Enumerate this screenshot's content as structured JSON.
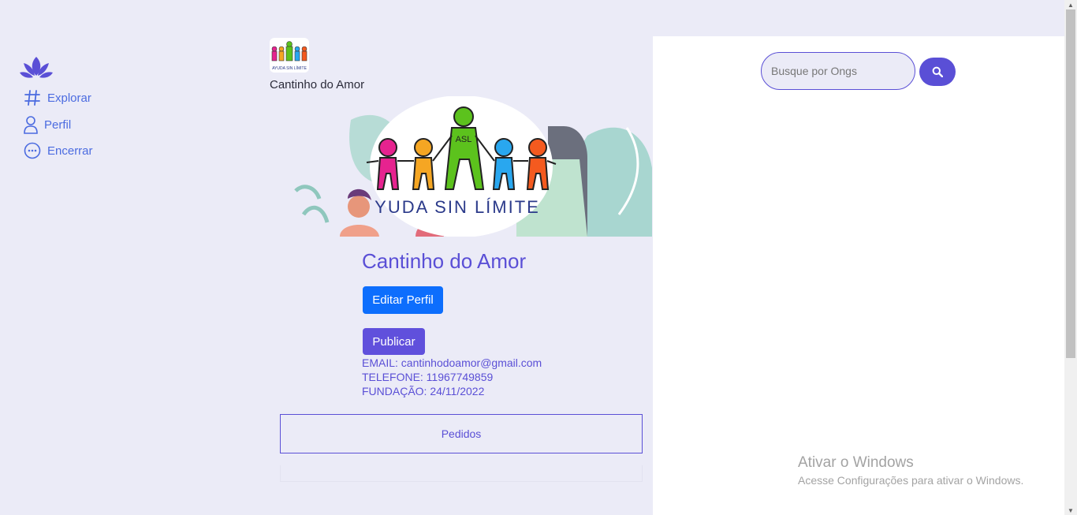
{
  "sidebar": {
    "items": [
      {
        "label": "Explorar",
        "icon": "hash-icon"
      },
      {
        "label": "Perfil",
        "icon": "user-icon"
      },
      {
        "label": "Encerrar",
        "icon": "more-circle-icon"
      }
    ]
  },
  "header": {
    "name": "Cantinho do Amor"
  },
  "profile": {
    "name": "Cantinho do Amor",
    "edit_label": "Editar Perfil",
    "publish_label": "Publicar",
    "email": "EMAIL: cantinhodoamor@gmail.com",
    "phone": "TELEFONE: 11967749859",
    "founded": "FUNDAÇÃO: 24/11/2022",
    "banner_text": "YUDA SIN LÍMITE",
    "banner_badge": "ASL",
    "avatar_text": "AYUDA SIN LÍMITE"
  },
  "pedidos": {
    "label": "Pedidos"
  },
  "search": {
    "placeholder": "Busque por Ongs"
  },
  "watermark": {
    "title": "Ativar o Windows",
    "subtitle": "Acesse Configurações para ativar o Windows."
  },
  "colors": {
    "accent": "#5a4fd6",
    "edit_button": "#0d6efd",
    "publish_button": "#6050dc",
    "background": "#ebebf7"
  }
}
